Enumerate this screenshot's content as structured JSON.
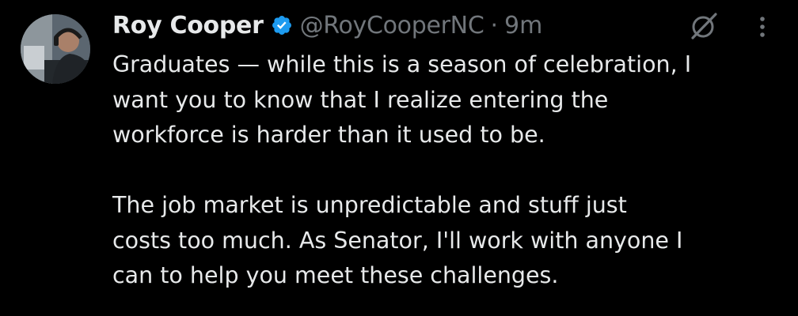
{
  "tweet": {
    "author_name": "Roy Cooper",
    "verified": true,
    "handle": "@RoyCooperNC",
    "separator": "·",
    "timestamp": "9m",
    "text": "Graduates — while this is a season of celebration, I\nwant you to know that I realize entering the\nworkforce is harder than it used to be.\n\nThe job market is unpredictable and stuff just\ncosts too much. As Senator, I'll work with anyone I\ncan to help you meet these challenges."
  },
  "icons": {
    "verified": "verified-badge-icon",
    "grok": "grok-icon",
    "more": "more-vertical-icon"
  },
  "colors": {
    "background": "#000000",
    "primary_text": "#e7e9ea",
    "secondary_text": "#71767b",
    "verified_blue": "#1d9bf0"
  }
}
